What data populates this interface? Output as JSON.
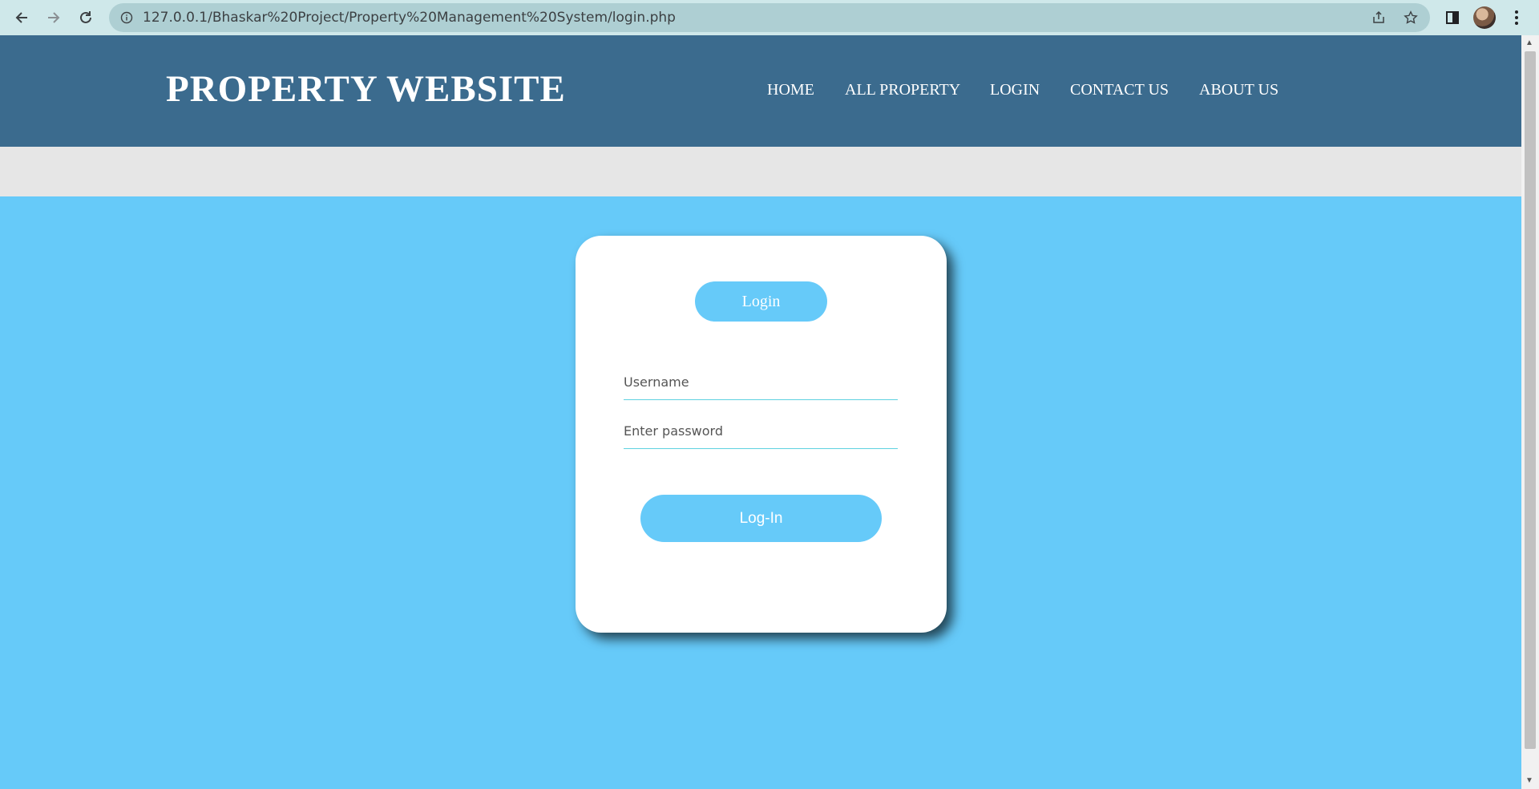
{
  "browser": {
    "url": "127.0.0.1/Bhaskar%20Project/Property%20Management%20System/login.php",
    "icons": [
      "back-icon",
      "forward-icon",
      "reload-icon",
      "info-icon",
      "share-icon",
      "star-icon",
      "side-panel-icon",
      "avatar",
      "more-icon"
    ]
  },
  "header": {
    "logo": "PROPERTY WEBSITE",
    "menu": [
      "HOME",
      "ALL PROPERTY",
      "LOGIN",
      "CONTACT US",
      "ABOUT US"
    ]
  },
  "login": {
    "title": "Login",
    "username_placeholder": "Username",
    "password_placeholder": "Enter password",
    "submit_label": "Log-In"
  },
  "colors": {
    "header_bg": "#3b6b8e",
    "band_bg": "#e6e6e6",
    "page_bg": "#66caf9",
    "accent": "#66caf9",
    "card_bg": "#ffffff"
  }
}
